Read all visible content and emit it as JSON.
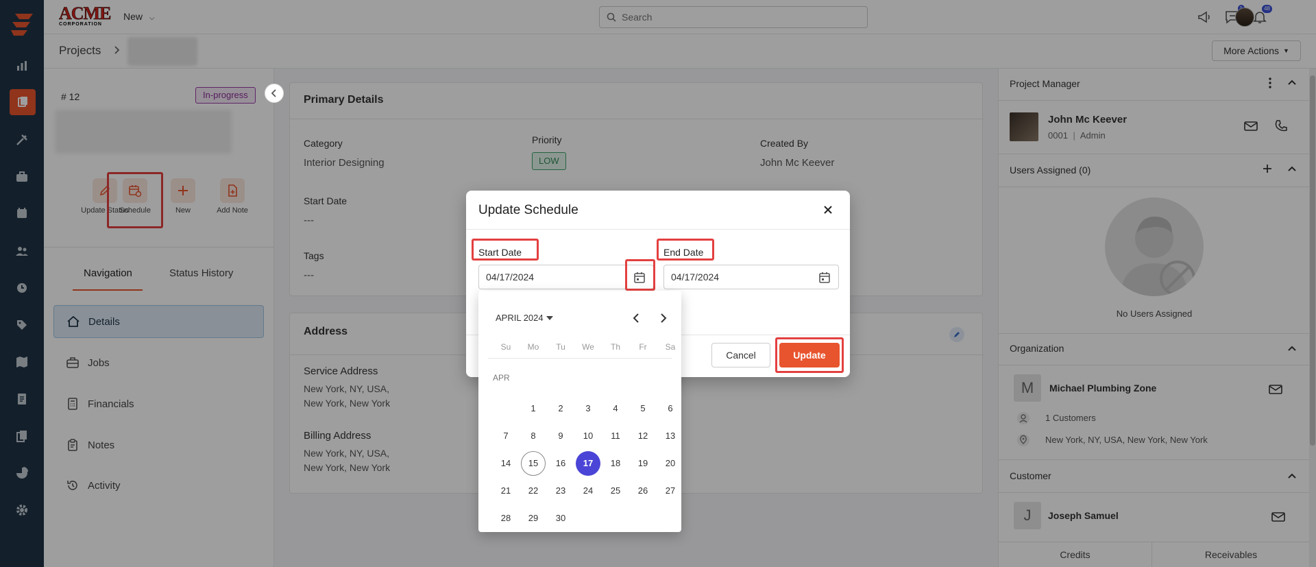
{
  "app": {
    "new_label": "New",
    "search_placeholder": "Search",
    "chat_badge": "1",
    "notif_badge": "48",
    "brand_line1": "ACME",
    "brand_line2": "CORPORATION"
  },
  "breadcrumb": {
    "root": "Projects",
    "more_actions": "More Actions"
  },
  "project": {
    "id": "# 12",
    "status": "In-progress",
    "actions": [
      {
        "label": "Update Status"
      },
      {
        "label": "Schedule"
      },
      {
        "label": "New"
      },
      {
        "label": "Add Note"
      }
    ],
    "tabs": [
      "Navigation",
      "Status History"
    ],
    "nav": [
      "Details",
      "Jobs",
      "Financials",
      "Notes",
      "Activity"
    ]
  },
  "primary": {
    "title": "Primary Details",
    "category_label": "Category",
    "category_value": "Interior Designing",
    "priority_label": "Priority",
    "priority_value": "LOW",
    "created_label": "Created By",
    "created_value": "John Mc Keever",
    "start_label": "Start Date",
    "start_value": "---",
    "tags_label": "Tags",
    "tags_value": "---"
  },
  "address": {
    "title": "Address",
    "service_label": "Service Address",
    "service_line1": "New York, NY, USA,",
    "service_line2": "New York, New York",
    "billing_label": "Billing Address",
    "billing_line1": "New York, NY, USA,",
    "billing_line2": "New York, New York"
  },
  "right": {
    "pm_title": "Project Manager",
    "pm_name": "John Mc Keever",
    "pm_id": "0001",
    "pm_role": "Admin",
    "users_title": "Users Assigned (0)",
    "no_users": "No Users Assigned",
    "org_title": "Organization",
    "org_letter": "M",
    "org_name": "Michael Plumbing Zone",
    "org_customers": "1 Customers",
    "org_address": "New York, NY, USA, New York, New York",
    "cust_title": "Customer",
    "cust_letter": "J",
    "cust_name": "Joseph Samuel",
    "tab_credits": "Credits",
    "tab_receivables": "Receivables"
  },
  "dialog": {
    "title": "Update Schedule",
    "start_label": "Start Date",
    "start_value": "04/17/2024",
    "end_label": "End Date",
    "end_value": "04/17/2024",
    "cancel": "Cancel",
    "update": "Update"
  },
  "picker": {
    "month": "APRIL 2024",
    "month_short": "APR",
    "weekdays": [
      "Su",
      "Mo",
      "Tu",
      "We",
      "Th",
      "Fr",
      "Sa"
    ],
    "first_weekday": 1,
    "days_in_month": 30,
    "today": 15,
    "selected": 17
  },
  "colors": {
    "accent": "#e8542e",
    "rail": "#1f3446",
    "selected_day": "#4a45d6",
    "highlight": "#e34040"
  }
}
